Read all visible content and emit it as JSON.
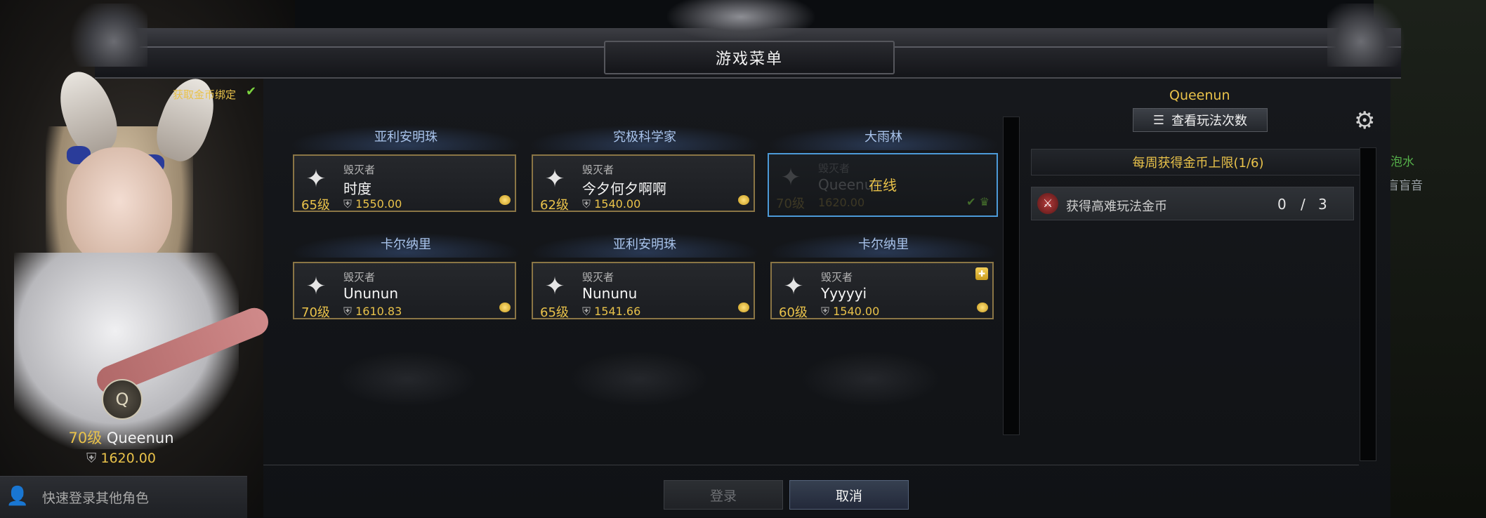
{
  "window_title": "游戏菜单",
  "left_panel": {
    "gold_bind_label": "获取金币绑定",
    "character": {
      "level": "70级",
      "name": "Queenun",
      "power": "1620.00"
    },
    "quick_login_label": "快速登录其他角色"
  },
  "characters": [
    {
      "server": "亚利安明珠",
      "class": "毁灭者",
      "name": "时度",
      "level": "65级",
      "power": "1550.00"
    },
    {
      "server": "究极科学家",
      "class": "毁灭者",
      "name": "今夕何夕啊啊",
      "level": "62级",
      "power": "1540.00"
    },
    {
      "server": "大雨林",
      "class": "毁灭者",
      "name": "Queenun",
      "level": "70级",
      "power": "1620.00",
      "selected": true,
      "status": "在线"
    },
    {
      "server": "卡尔纳里",
      "class": "毁灭者",
      "name": "Unun­un",
      "level": "70级",
      "power": "1610.83"
    },
    {
      "server": "亚利安明珠",
      "class": "毁灭者",
      "name": "Nununu",
      "level": "65级",
      "power": "1541.66"
    },
    {
      "server": "卡尔纳里",
      "class": "毁灭者",
      "name": "Yyyyyi",
      "level": "60级",
      "power": "1540.00",
      "gift": true
    }
  ],
  "right_panel": {
    "name": "Queenun",
    "view_button_label": "查看玩法次数",
    "weekly_header": "每周获得金币上限(1/6)",
    "task": {
      "label": "获得高难玩法金币",
      "done": "0",
      "slash": "/",
      "total": "3"
    }
  },
  "buttons": {
    "login": "登录",
    "cancel": "取消"
  },
  "background_text": {
    "line1": "泡水",
    "line2": "盲盲音"
  },
  "colors": {
    "accent_gold": "#e9c24a",
    "selected_border": "#4c9ad8",
    "card_border": "#8a7545"
  }
}
